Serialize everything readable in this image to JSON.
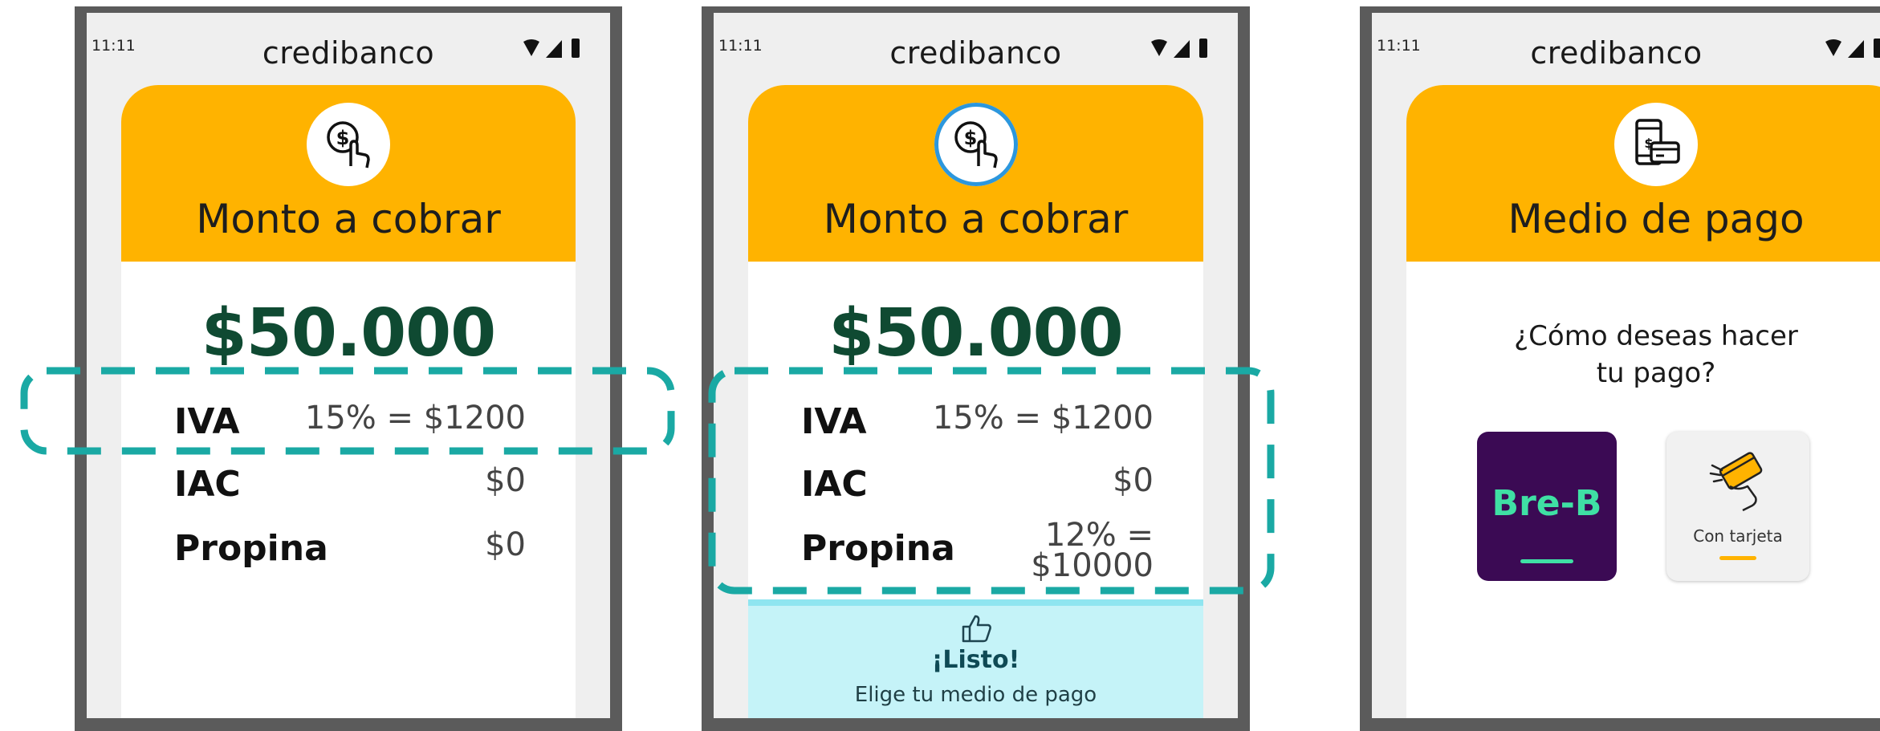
{
  "screens": [
    {
      "time": "11:11",
      "brand": "credibanco",
      "icon": "dollar-tap-icon",
      "title": "Monto a cobrar",
      "amount": "$50.000",
      "rows": [
        {
          "label": "IVA",
          "value": "15% = $1200"
        },
        {
          "label": "IAC",
          "value": "$0"
        },
        {
          "label": "Propina",
          "value": "$0"
        }
      ]
    },
    {
      "time": "11:11",
      "brand": "credibanco",
      "icon": "dollar-tap-icon",
      "title": "Monto a cobrar",
      "amount": "$50.000",
      "rows": [
        {
          "label": "IVA",
          "value": "15% = $1200"
        },
        {
          "label": "IAC",
          "value": "$0"
        },
        {
          "label": "Propina",
          "value": "12% =",
          "value2": "$10000"
        }
      ],
      "ready": {
        "icon": "thumbs-up-icon",
        "title": "¡Listo!",
        "subtitle": "Elige tu medio de pago"
      }
    },
    {
      "time": "11:11",
      "brand": "credibanco",
      "icon": "phone-card-payment-icon",
      "title": "Medio de pago",
      "question_line1": "¿Cómo deseas hacer",
      "question_line2": "tu pago?",
      "options": [
        {
          "label": "Bre-B",
          "icon": "bre-b-logo"
        },
        {
          "label": "Con tarjeta",
          "icon": "card-tap-icon"
        }
      ]
    }
  ],
  "colors": {
    "header": "#ffb300",
    "amount": "#0f4a32",
    "highlight_dash": "#1aa9a4",
    "ready_bg": "#c5f3f8",
    "breb_bg": "#3b0a54",
    "breb_green": "#3fe0a4"
  }
}
